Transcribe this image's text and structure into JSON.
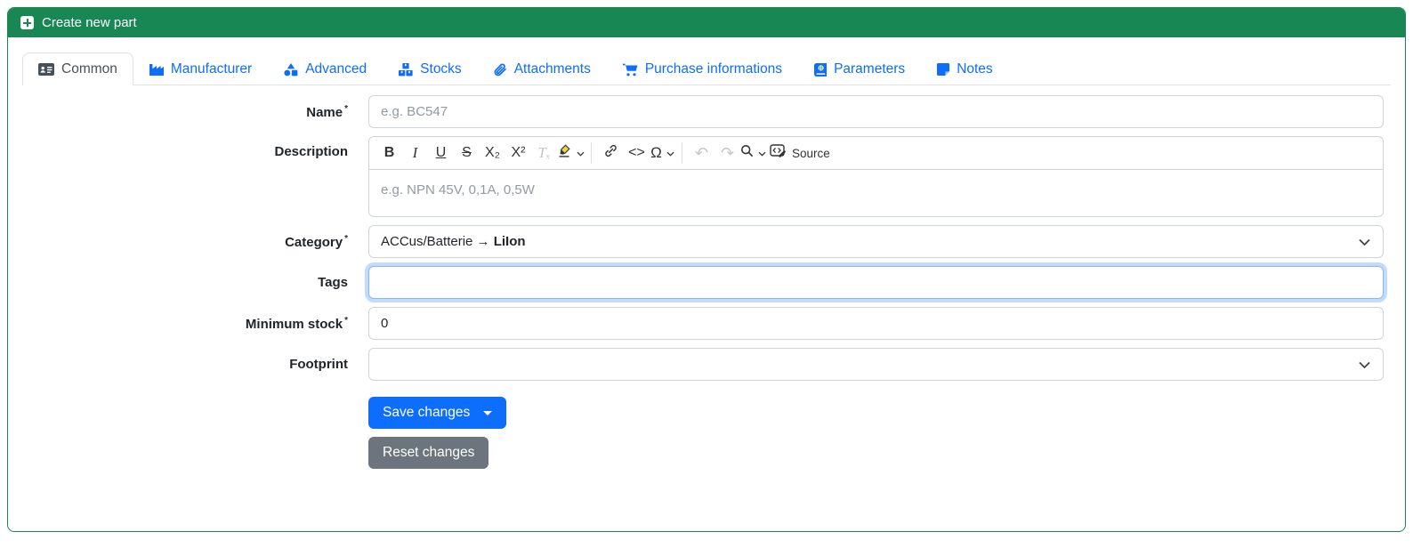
{
  "header": {
    "title": "Create new part",
    "icon": "square-plus-icon"
  },
  "tabs": [
    {
      "label": "Common",
      "icon": "id-card-icon",
      "active": true
    },
    {
      "label": "Manufacturer",
      "icon": "factory-icon",
      "active": false
    },
    {
      "label": "Advanced",
      "icon": "shapes-icon",
      "active": false
    },
    {
      "label": "Stocks",
      "icon": "boxes-icon",
      "active": false
    },
    {
      "label": "Attachments",
      "icon": "paperclip-icon",
      "active": false
    },
    {
      "label": "Purchase informations",
      "icon": "cart-icon",
      "active": false
    },
    {
      "label": "Parameters",
      "icon": "book-icon",
      "active": false
    },
    {
      "label": "Notes",
      "icon": "sticky-note-icon",
      "active": false
    }
  ],
  "form": {
    "name": {
      "label": "Name",
      "required_mark": "*",
      "placeholder": "e.g. BC547",
      "value": ""
    },
    "description": {
      "label": "Description",
      "placeholder": "e.g. NPN 45V, 0,1A, 0,5W",
      "value": "",
      "toolbar": {
        "bold": "B",
        "italic": "I",
        "underline": "U",
        "strikethrough": "S",
        "subscript": "X₂",
        "superscript": "X²",
        "remove_format": "Tₓ",
        "code": "<>",
        "special_char": "Ω",
        "undo": "↶",
        "redo": "↷",
        "source_label": "Source"
      }
    },
    "category": {
      "label": "Category",
      "required_mark": "*",
      "value_prefix": "ACCus/Batterie → ",
      "value_bold": "LiIon"
    },
    "tags": {
      "label": "Tags",
      "value": "",
      "placeholder": "",
      "focused": true
    },
    "minimum_stock": {
      "label": "Minimum stock",
      "required_mark": "*",
      "value": "0"
    },
    "footprint": {
      "label": "Footprint",
      "value": ""
    },
    "buttons": {
      "save": "Save changes",
      "reset": "Reset changes"
    }
  },
  "colors": {
    "success_green": "#198754",
    "primary_blue": "#0d6efd",
    "secondary_gray": "#6c757d",
    "tab_border": "#dee2e6",
    "input_border": "#ced4da",
    "focus_ring": "#86b7fe",
    "placeholder_gray": "#929aa1",
    "highlighter_yellow": "#f2d13f"
  }
}
